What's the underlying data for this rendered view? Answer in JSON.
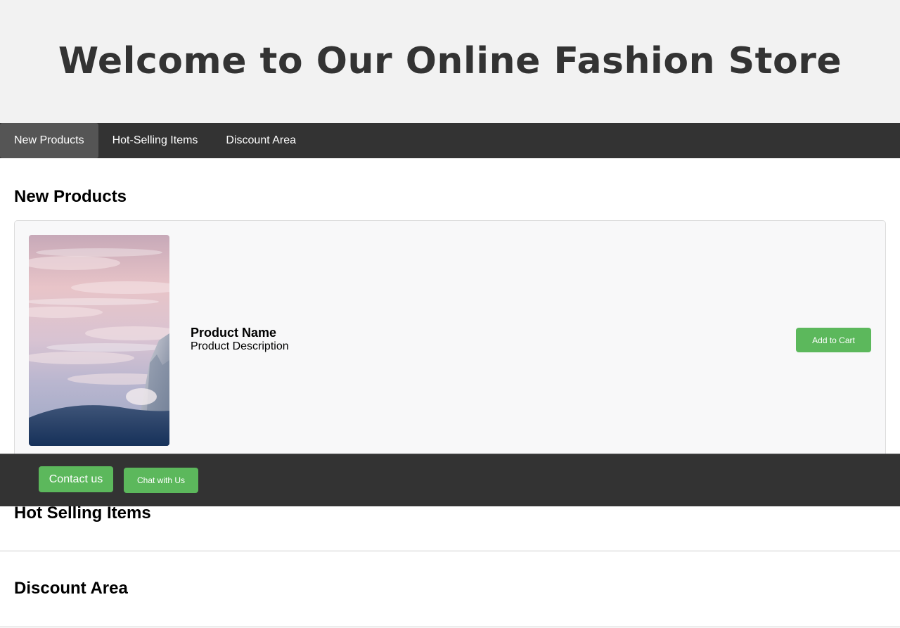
{
  "header": {
    "title": "Welcome to Our Online Fashion Store"
  },
  "nav": {
    "items": [
      {
        "label": "New Products",
        "active": true
      },
      {
        "label": "Hot-Selling Items",
        "active": false
      },
      {
        "label": "Discount Area",
        "active": false
      }
    ]
  },
  "sections": {
    "new_products": {
      "heading": "New Products",
      "product": {
        "name": "Product Name",
        "description": "Product Description",
        "add_to_cart_label": "Add to Cart"
      }
    },
    "hot_selling": {
      "heading": "Hot Selling Items"
    },
    "discount": {
      "heading": "Discount Area"
    }
  },
  "footer": {
    "contact_label": "Contact us",
    "chat_label": "Chat with Us"
  },
  "colors": {
    "header_bg": "#f2f2f2",
    "nav_bg": "#333333",
    "nav_active_bg": "#555555",
    "accent_green": "#5cb85c",
    "card_bg": "#f8f8f9"
  }
}
